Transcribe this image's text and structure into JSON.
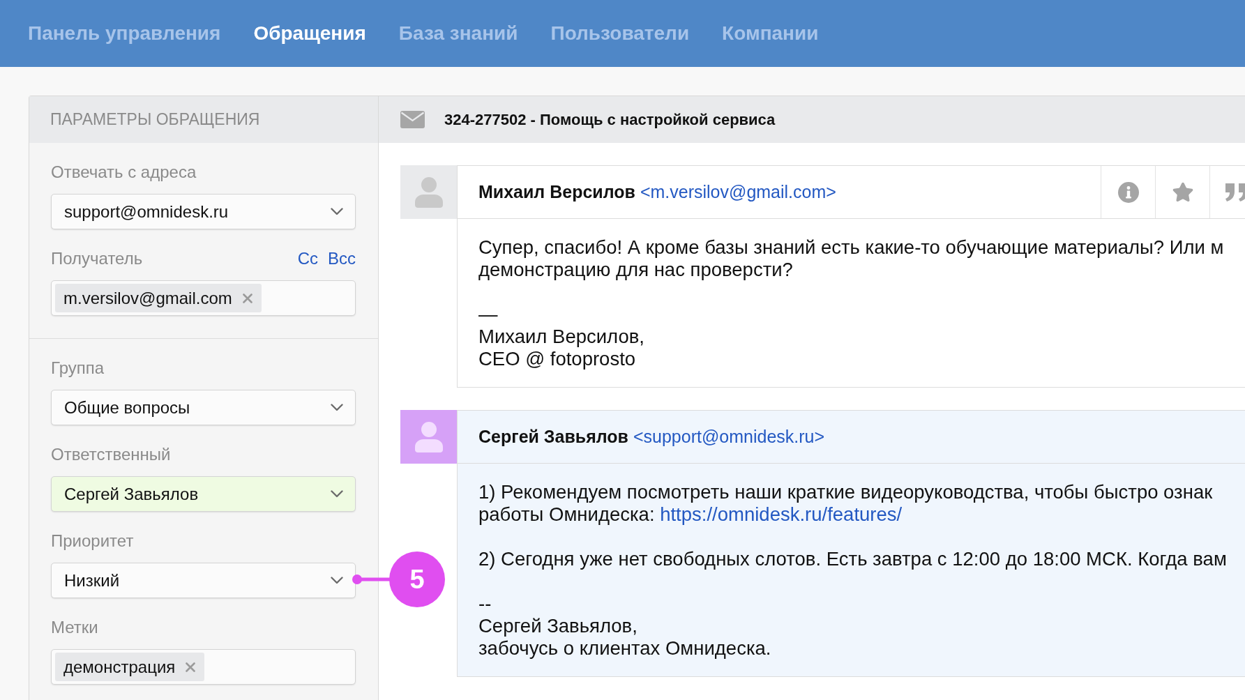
{
  "nav": {
    "tabs": [
      {
        "label": "Панель управления",
        "selected": false
      },
      {
        "label": "Обращения",
        "selected": true
      },
      {
        "label": "База знаний",
        "selected": false
      },
      {
        "label": "Пользователи",
        "selected": false
      },
      {
        "label": "Компании",
        "selected": false
      }
    ]
  },
  "ticket_params": {
    "title": "ПАРАМЕТРЫ ОБРАЩЕНИЯ",
    "sections": [
      {
        "fields": [
          {
            "kind": "select",
            "label": "Отвечать с адреса",
            "value": "support@omnidesk.ru",
            "highlighted": false
          },
          {
            "kind": "tags",
            "label": "Получатель",
            "links": [
              "Cc",
              "Bcc"
            ],
            "tags": [
              "m.versilov@gmail.com"
            ]
          }
        ]
      },
      {
        "fields": [
          {
            "kind": "select",
            "label": "Группа",
            "value": "Общие вопросы",
            "highlighted": false
          },
          {
            "kind": "select",
            "label": "Ответственный",
            "value": "Сергей Завьялов",
            "highlighted": true
          },
          {
            "kind": "select",
            "label": "Приоритет",
            "value": "Низкий",
            "highlighted": false
          },
          {
            "kind": "tags",
            "label": "Метки",
            "tags": [
              "демонстрация"
            ]
          }
        ]
      }
    ]
  },
  "ticket": {
    "title": "324-277502 - Помощь с настройкой сервиса",
    "messages": [
      {
        "kind": "customer",
        "author": "Михаил Версилов",
        "email": "<m.versilov@gmail.com>",
        "paragraphs": [
          [
            "Супер, спасибо! А кроме базы знаний есть какие-то обучающие материалы? Или м",
            "демонстрацию для нас проверсти?"
          ],
          [
            "—",
            "Михаил Версилов,",
            "CEO @ fotoprosto"
          ]
        ]
      },
      {
        "kind": "agent",
        "author": "Сергей Завьялов",
        "email": "<support@omnidesk.ru>",
        "paragraphs": [
          [
            "1) Рекомендуем посмотреть наши краткие видеоруководства, чтобы быстро ознак",
            {
              "text": "работы Омнидеска: ",
              "link": "https://omnidesk.ru/features/"
            }
          ],
          [
            "2) Сегодня уже нет свободных слотов. Есть завтра с 12:00 до 18:00 МСК. Когда вам"
          ],
          [
            "--",
            "Сергей Завьялов,",
            "забочусь о клиентах Омнидеска."
          ]
        ]
      }
    ]
  },
  "callout": {
    "number": "5"
  }
}
